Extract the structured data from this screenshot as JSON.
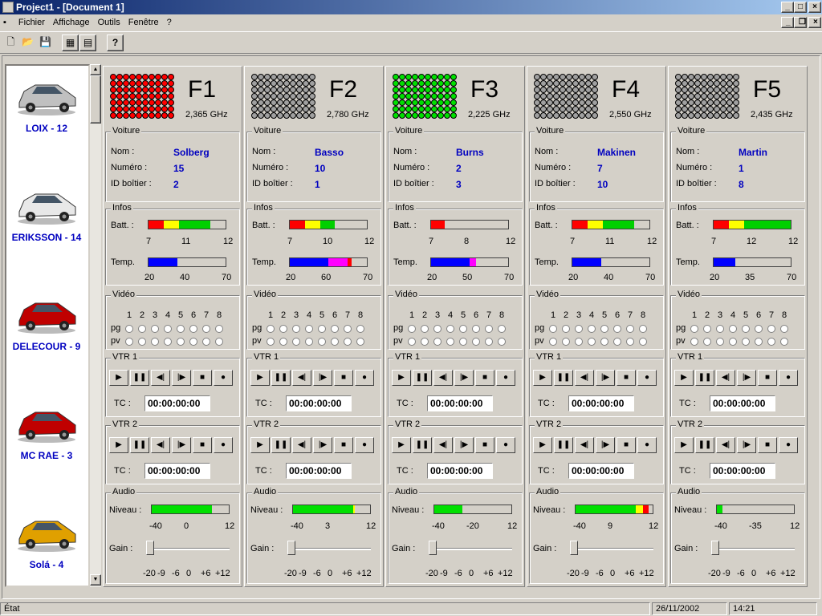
{
  "window": {
    "title": "Project1 - [Document 1]"
  },
  "menu": [
    "Fichier",
    "Affichage",
    "Outils",
    "Fenêtre",
    "?"
  ],
  "toolbar": [
    {
      "icon": "new-file-icon"
    },
    {
      "icon": "open-folder-icon"
    },
    {
      "icon": "save-disk-icon"
    },
    {
      "icon": "grid-view-icon"
    },
    {
      "icon": "properties-icon"
    },
    {
      "icon": "help-icon",
      "glyph": "?"
    }
  ],
  "cars": [
    {
      "label": "LOIX  -  12",
      "color": "#c0c0c0"
    },
    {
      "label": "ERIKSSON  -  14",
      "color": "#e8e8e8"
    },
    {
      "label": "DELECOUR - 9",
      "color": "#c00000"
    },
    {
      "label": "MC RAE  -  3",
      "color": "#c00000"
    },
    {
      "label": "Solá  -  4",
      "color": "#e0a000"
    }
  ],
  "labels": {
    "voiture": "Voiture",
    "nom": "Nom :",
    "numero": "Numéro :",
    "id": "ID boîtier :",
    "infos": "Infos",
    "batt": "Batt. :",
    "temp": "Temp.",
    "video": "Vidéo",
    "pg": "pg",
    "pv": "pv",
    "vtr1": "VTR 1",
    "vtr2": "VTR 2",
    "tc": "TC :",
    "audio": "Audio",
    "niveau": "Niveau :",
    "gain": "Gain :",
    "video_nums": [
      "1",
      "2",
      "3",
      "4",
      "5",
      "6",
      "7",
      "8"
    ],
    "gain_ticks": [
      "-20",
      "-9",
      "-6",
      "0",
      "+6",
      "+12"
    ]
  },
  "channels": [
    {
      "name": "F1",
      "freq": "2,365 GHz",
      "led_color": "#ff0000",
      "driver": "Solberg",
      "number": "15",
      "box_id": "2",
      "batt": {
        "level": 0.8,
        "ticks": [
          "7",
          "11",
          "12"
        ]
      },
      "temp": {
        "level": 0.38,
        "ticks": [
          "20",
          "40",
          "70"
        ]
      },
      "tc1": "00:00:00:00",
      "tc2": "00:00:00:00",
      "audio": {
        "level": 0.78,
        "ticks": [
          "-40",
          "0",
          "12"
        ]
      }
    },
    {
      "name": "F2",
      "freq": "2,780 GHz",
      "led_color": "#a0a0a0",
      "driver": "Basso",
      "number": "10",
      "box_id": "1",
      "batt": {
        "level": 0.58,
        "ticks": [
          "7",
          "10",
          "12"
        ]
      },
      "temp": {
        "level": 0.8,
        "ticks": [
          "20",
          "60",
          "70"
        ]
      },
      "tc1": "00:00:00:00",
      "tc2": "00:00:00:00",
      "audio": {
        "level": 0.8,
        "ticks": [
          "-40",
          "3",
          "12"
        ]
      }
    },
    {
      "name": "F3",
      "freq": "2,225 GHz",
      "led_color": "#00e000",
      "driver": "Burns",
      "number": "2",
      "box_id": "3",
      "batt": {
        "level": 0.18,
        "ticks": [
          "7",
          "8",
          "12"
        ]
      },
      "temp": {
        "level": 0.58,
        "ticks": [
          "20",
          "50",
          "70"
        ]
      },
      "tc1": "00:00:00:00",
      "tc2": "00:00:00:00",
      "audio": {
        "level": 0.36,
        "ticks": [
          "-40",
          "-20",
          "12"
        ]
      }
    },
    {
      "name": "F4",
      "freq": "2,550 GHz",
      "led_color": "#a0a0a0",
      "driver": "Makinen",
      "number": "7",
      "box_id": "10",
      "batt": {
        "level": 0.8,
        "ticks": [
          "7",
          "11",
          "12"
        ]
      },
      "temp": {
        "level": 0.38,
        "ticks": [
          "20",
          "40",
          "70"
        ]
      },
      "tc1": "00:00:00:00",
      "tc2": "00:00:00:00",
      "audio": {
        "level": 0.95,
        "ticks": [
          "-40",
          "9",
          "12"
        ]
      }
    },
    {
      "name": "F5",
      "freq": "2,435 GHz",
      "led_color": "#a0a0a0",
      "driver": "Martin",
      "number": "1",
      "box_id": "8",
      "batt": {
        "level": 1.0,
        "ticks": [
          "7",
          "12",
          "12"
        ]
      },
      "temp": {
        "level": 0.28,
        "ticks": [
          "20",
          "35",
          "70"
        ]
      },
      "tc1": "00:00:00:00",
      "tc2": "00:00:00:00",
      "audio": {
        "level": 0.07,
        "ticks": [
          "-40",
          "-35",
          "12"
        ]
      }
    }
  ],
  "status": {
    "text": "État",
    "date": "26/11/2002",
    "time": "14:21"
  }
}
